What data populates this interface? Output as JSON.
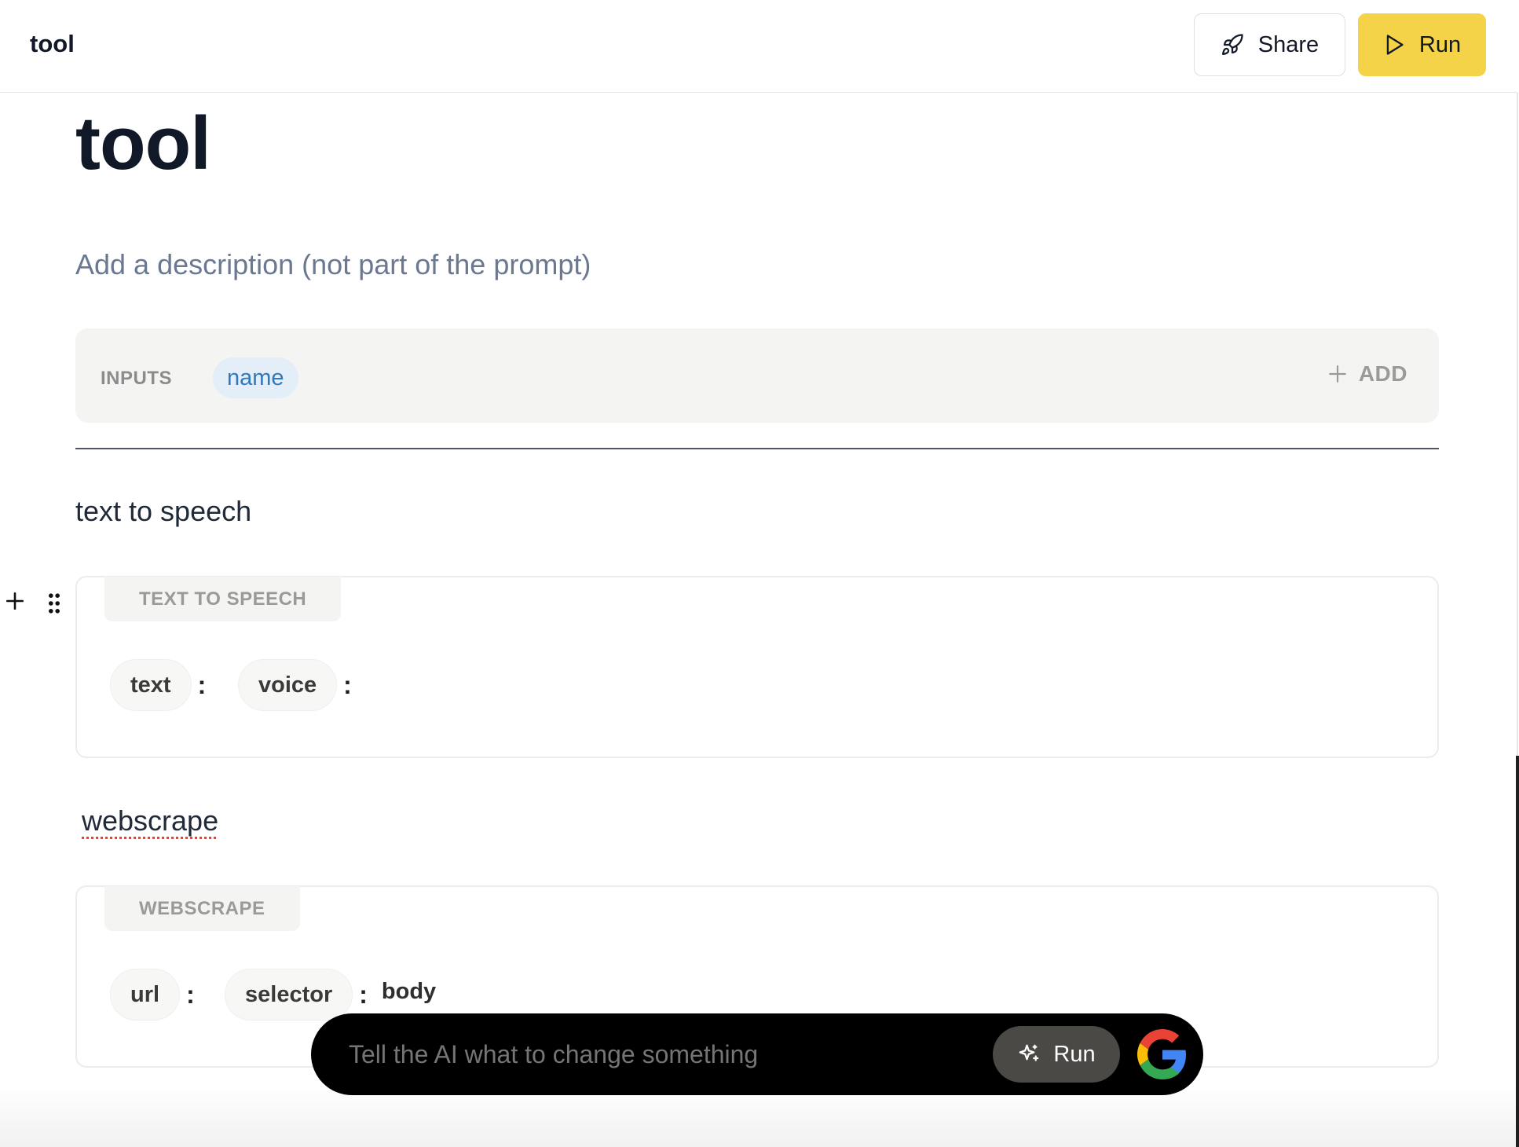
{
  "header": {
    "app_title": "tool",
    "share_label": "Share",
    "run_label": "Run",
    "share_icon": "rocket-icon",
    "run_icon": "play-icon"
  },
  "page": {
    "title": "tool",
    "description_placeholder": "Add a description (not part of the prompt)"
  },
  "inputs": {
    "label": "INPUTS",
    "items": [
      "name"
    ],
    "add_label": "ADD"
  },
  "blocks": [
    {
      "heading": "text to speech",
      "tag": "TEXT TO SPEECH",
      "params": [
        {
          "name": "text",
          "value": ""
        },
        {
          "name": "voice",
          "value": ""
        }
      ]
    },
    {
      "heading": "webscrape",
      "tag": "WEBSCRAPE",
      "params": [
        {
          "name": "url",
          "value": ""
        },
        {
          "name": "selector",
          "value": "body"
        }
      ]
    }
  ],
  "ai_bar": {
    "placeholder": "Tell the AI what to change something",
    "run_label": "Run",
    "run_icon": "sparkle-icon",
    "avatar_icon": "google-icon"
  },
  "colors": {
    "run_button": "#f4d348",
    "input_chip_bg": "#e3eef8",
    "input_chip_text": "#2f78be",
    "ai_bar_bg": "#000000"
  }
}
